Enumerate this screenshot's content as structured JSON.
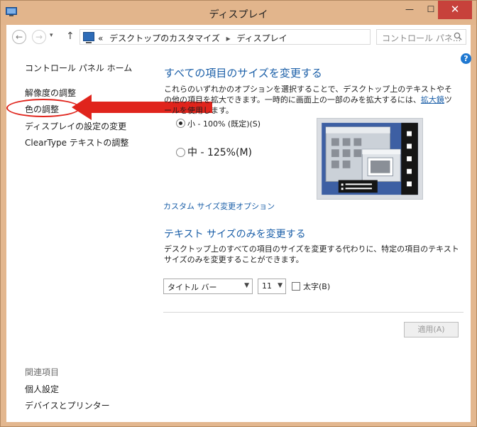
{
  "window": {
    "title": "ディスプレイ"
  },
  "controls": {
    "minimize": "—",
    "maximize": "☐",
    "close": "✕"
  },
  "nav": {
    "back": "←",
    "forward": "→",
    "recent": "▾",
    "up": "↑",
    "breadcrumb": [
      "«",
      "デスクトップのカスタマイズ",
      "ディスプレイ"
    ],
    "separator": "▸",
    "dropdown": "⌄",
    "refresh": "↻",
    "search_placeholder": "コントロール パネ..."
  },
  "help": "?",
  "sidebar": {
    "home": "コントロール パネル ホーム",
    "items": [
      "解像度の調整",
      "色の調整",
      "ディスプレイの設定の変更",
      "ClearType テキストの調整"
    ],
    "related_header": "関連項目",
    "related": [
      "個人設定",
      "デバイスとプリンター"
    ]
  },
  "main": {
    "section1_title": "すべての項目のサイズを変更する",
    "section1_desc_before": "これらのいずれかのオプションを選択することで、デスクトップ上のテキストやその他の項目を拡大できます。一時的に画面上の一部のみを拡大するには、",
    "section1_desc_link": "拡大鏡",
    "section1_desc_after": "ツールを使用します。",
    "option_small": "小 - 100% (既定)(S)",
    "option_medium": "中 - 125%(M)",
    "custom_link": "カスタム サイズ変更オプション",
    "section2_title": "テキスト サイズのみを変更する",
    "section2_desc": "デスクトップ上のすべての項目のサイズを変更する代わりに、特定の項目のテキスト サイズのみを変更することができます。",
    "item_select": "タイトル バー",
    "size_select": "11",
    "bold_label": "太字(B)",
    "apply_button": "適用(A)"
  },
  "colors": {
    "accent": "#1b5fa8",
    "annotation": "#e0241c",
    "close": "#c7413b"
  }
}
